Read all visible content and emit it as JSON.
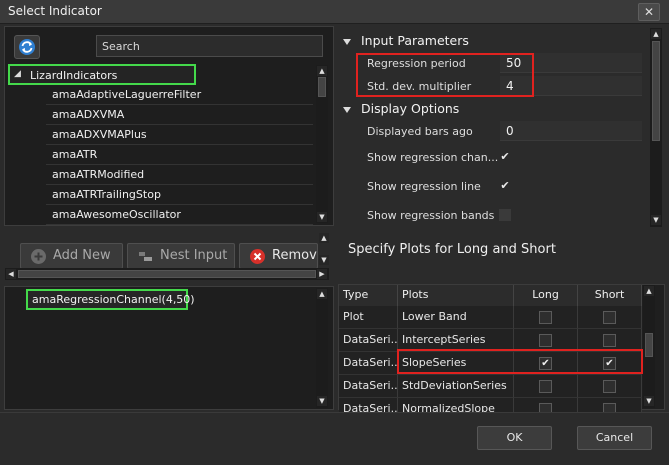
{
  "window": {
    "title": "Select Indicator",
    "close_glyph": "✕"
  },
  "search": {
    "placeholder": "Search"
  },
  "tree": {
    "parent": "LizardIndicators",
    "items": [
      "amaAdaptiveLaguerreFilter",
      "amaADXVMA",
      "amaADXVMAPlus",
      "amaATR",
      "amaATRModified",
      "amaATRTrailingStop",
      "amaAwesomeOscillator"
    ]
  },
  "toolbar": {
    "add_new": "Add New",
    "nest_input": "Nest Input",
    "remove": "Remov"
  },
  "selected": {
    "items": [
      "amaRegressionChannel(4,50)"
    ]
  },
  "properties": {
    "input_section": "Input Parameters",
    "regression_period_label": "Regression period",
    "regression_period_value": "50",
    "std_dev_label": "Std. dev. multiplier",
    "std_dev_value": "4",
    "display_section": "Display Options",
    "displayed_bars_label": "Displayed bars ago",
    "displayed_bars_value": "0",
    "show_channel_label": "Show regression chan...",
    "show_channel_checked": true,
    "show_line_label": "Show regression line",
    "show_line_checked": true,
    "show_bands_label": "Show regression bands",
    "show_bands_checked": false
  },
  "plots": {
    "caption": "Specify Plots for Long and Short",
    "headers": {
      "type": "Type",
      "plots": "Plots",
      "long": "Long",
      "short": "Short"
    },
    "rows": [
      {
        "type": "Plot",
        "plot": "Lower Band",
        "long": false,
        "short": false
      },
      {
        "type": "DataSeri...",
        "plot": "InterceptSeries",
        "long": false,
        "short": false
      },
      {
        "type": "DataSeri...",
        "plot": "SlopeSeries",
        "long": true,
        "short": true
      },
      {
        "type": "DataSeri...",
        "plot": "StdDeviationSeries",
        "long": false,
        "short": false
      },
      {
        "type": "DataSeri...",
        "plot": "NormalizedSlope",
        "long": false,
        "short": false
      }
    ]
  },
  "footer": {
    "ok": "OK",
    "cancel": "Cancel"
  },
  "colors": {
    "highlight_green": "#44d94b",
    "highlight_red": "#e0221f",
    "background": "#2b2b2b"
  },
  "icons": [
    "refresh-icon",
    "add-icon",
    "nest-input-icon",
    "remove-icon",
    "close-icon"
  ]
}
